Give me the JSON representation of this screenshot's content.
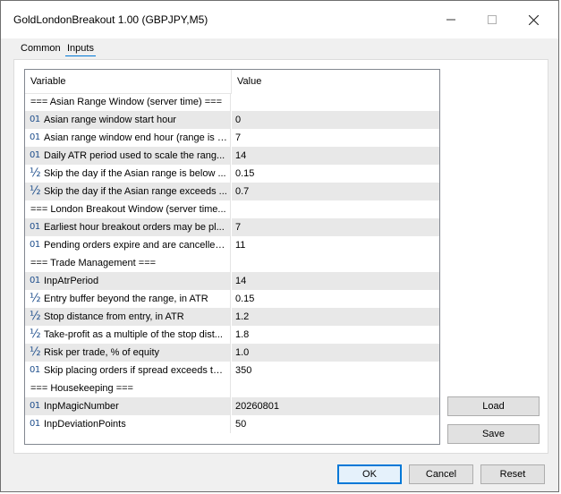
{
  "window": {
    "title": "GoldLondonBreakout 1.00 (GBPJPY,M5)"
  },
  "tabs": [
    {
      "label": "Common"
    },
    {
      "label": "Inputs"
    }
  ],
  "grid": {
    "columns": {
      "variable": "Variable",
      "value": "Value"
    },
    "rows": [
      {
        "kind": "section",
        "label": "=== Asian Range Window (server time) ===",
        "value": ""
      },
      {
        "kind": "int",
        "label": "Asian range window start hour",
        "value": "0"
      },
      {
        "kind": "int",
        "label": "Asian range window end hour (range is l...",
        "value": "7"
      },
      {
        "kind": "int",
        "label": "Daily ATR period used to scale the rang...",
        "value": "14"
      },
      {
        "kind": "double",
        "label": "Skip the day if the Asian range is below ...",
        "value": "0.15"
      },
      {
        "kind": "double",
        "label": "Skip the day if the Asian range exceeds ...",
        "value": "0.7"
      },
      {
        "kind": "section",
        "label": "=== London Breakout Window (server time...",
        "value": ""
      },
      {
        "kind": "int",
        "label": "Earliest hour breakout orders may be pl...",
        "value": "7"
      },
      {
        "kind": "int",
        "label": "Pending orders expire and are cancelled...",
        "value": "11"
      },
      {
        "kind": "section",
        "label": "=== Trade Management ===",
        "value": ""
      },
      {
        "kind": "int",
        "label": "InpAtrPeriod",
        "value": "14"
      },
      {
        "kind": "double",
        "label": "Entry buffer beyond the range, in ATR",
        "value": "0.15"
      },
      {
        "kind": "double",
        "label": "Stop distance from entry, in ATR",
        "value": "1.2"
      },
      {
        "kind": "double",
        "label": "Take-profit as a multiple of the stop dist...",
        "value": "1.8"
      },
      {
        "kind": "double",
        "label": "Risk per trade, % of equity",
        "value": "1.0"
      },
      {
        "kind": "int",
        "label": "Skip placing orders if spread exceeds thi...",
        "value": "350"
      },
      {
        "kind": "section",
        "label": "=== Housekeeping ===",
        "value": ""
      },
      {
        "kind": "int",
        "label": "InpMagicNumber",
        "value": "20260801"
      },
      {
        "kind": "int",
        "label": "InpDeviationPoints",
        "value": "50"
      }
    ]
  },
  "icons": {
    "int": "01",
    "double": "½"
  },
  "buttons": {
    "load": "Load",
    "save": "Save",
    "ok": "OK",
    "cancel": "Cancel",
    "reset": "Reset"
  },
  "colors": {
    "accent": "#0078d7",
    "row_shade": "#e8e8e8",
    "icon": "#1e4e8c"
  }
}
